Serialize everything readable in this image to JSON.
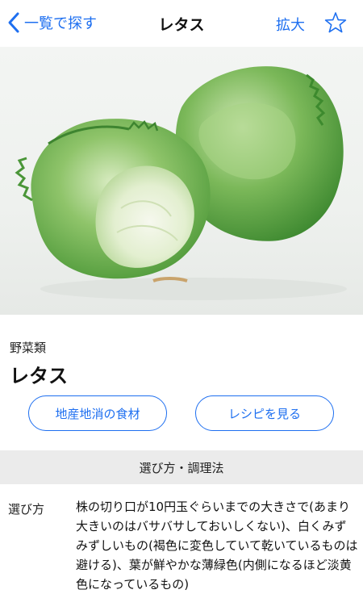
{
  "navbar": {
    "back_label": "一覧で探す",
    "title": "レタス",
    "zoom_label": "拡大",
    "back_icon": "chevron-left-icon",
    "favorite_icon": "star-outline-icon",
    "accent_color": "#1e6ff0"
  },
  "photo": {
    "subject": "lettuce-photo"
  },
  "item": {
    "category": "野菜類",
    "name": "レタス"
  },
  "buttons": {
    "local_food": "地産地消の食材",
    "recipe": "レシピを見る"
  },
  "section": {
    "title": "選び方・調理法"
  },
  "details": {
    "choose_label": "選び方",
    "choose_text": "株の切り口が10円玉ぐらいまでの大きさで(あまり大きいのはバサバサしておいしくない)、白くみずみずしいもの(褐色に変色していて乾いているものは避ける)、葉が鮮やかな薄緑色(内側になるほど淡黄色になっているもの)"
  }
}
